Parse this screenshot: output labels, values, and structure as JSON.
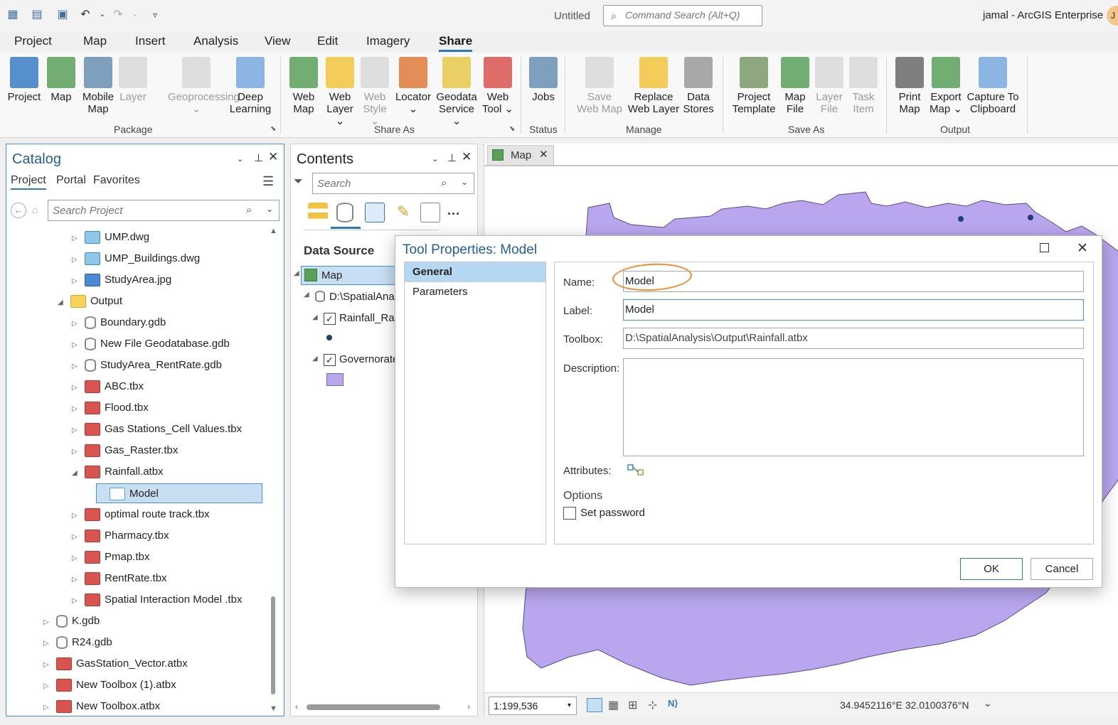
{
  "app": {
    "doc_title": "Untitled",
    "command_search_placeholder": "Command Search (Alt+Q)",
    "user_label": "jamal - ArcGIS Enterprise",
    "avatar_initial": "J"
  },
  "menu_tabs": [
    "Project",
    "Map",
    "Insert",
    "Analysis",
    "View",
    "Edit",
    "Imagery",
    "Share"
  ],
  "active_tab": "Share",
  "ribbon": {
    "groups": [
      {
        "label": "Package"
      },
      {
        "label": "Share As"
      },
      {
        "label": "Status"
      },
      {
        "label": "Manage"
      },
      {
        "label": "Save As"
      },
      {
        "label": "Output"
      }
    ],
    "buttons": [
      {
        "l1": "Project",
        "l2": "",
        "enabled": true,
        "color": "#3a7dc4"
      },
      {
        "l1": "Map",
        "l2": "",
        "enabled": true,
        "color": "#5aa05a"
      },
      {
        "l1": "Mobile",
        "l2": "Map",
        "enabled": true,
        "color": "#6a8fb5"
      },
      {
        "l1": "Layer",
        "l2": "",
        "enabled": false,
        "color": "#c9c9c9"
      },
      {
        "l1": "Geoprocessing",
        "l2": "⌄",
        "enabled": false,
        "color": "#c9c9c9"
      },
      {
        "l1": "Deep",
        "l2": "Learning",
        "enabled": true,
        "color": "#7aa9e0"
      },
      {
        "l1": "Web",
        "l2": "Map",
        "enabled": true,
        "color": "#5aa05a"
      },
      {
        "l1": "Web",
        "l2": "Layer ⌄",
        "enabled": true,
        "color": "#f2c43d"
      },
      {
        "l1": "Web",
        "l2": "Style ⌄",
        "enabled": false,
        "color": "#c9c9c9"
      },
      {
        "l1": "Locator",
        "l2": "⌄",
        "enabled": true,
        "color": "#e07a3a"
      },
      {
        "l1": "Geodata",
        "l2": "Service ⌄",
        "enabled": true,
        "color": "#e6c84a"
      },
      {
        "l1": "Web",
        "l2": "Tool ⌄",
        "enabled": true,
        "color": "#d9534f"
      },
      {
        "l1": "Jobs",
        "l2": "",
        "enabled": true,
        "color": "#6a8fb5"
      },
      {
        "l1": "Save",
        "l2": "Web Map",
        "enabled": false,
        "color": "#c9c9c9"
      },
      {
        "l1": "Replace",
        "l2": "Web Layer",
        "enabled": true,
        "color": "#f2c43d"
      },
      {
        "l1": "Data",
        "l2": "Stores",
        "enabled": true,
        "color": "#9a9a9a"
      },
      {
        "l1": "Project",
        "l2": "Template",
        "enabled": true,
        "color": "#7a9a6a"
      },
      {
        "l1": "Map",
        "l2": "File",
        "enabled": true,
        "color": "#5aa05a"
      },
      {
        "l1": "Layer",
        "l2": "File",
        "enabled": false,
        "color": "#c9c9c9"
      },
      {
        "l1": "Task",
        "l2": "Item",
        "enabled": false,
        "color": "#c9c9c9"
      },
      {
        "l1": "Print",
        "l2": "Map",
        "enabled": true,
        "color": "#6a6a6a"
      },
      {
        "l1": "Export",
        "l2": "Map ⌄",
        "enabled": true,
        "color": "#5aa05a"
      },
      {
        "l1": "Capture To",
        "l2": "Clipboard",
        "enabled": true,
        "color": "#7aa9e0"
      }
    ]
  },
  "catalog": {
    "title": "Catalog",
    "tabs": [
      "Project",
      "Portal",
      "Favorites"
    ],
    "search_placeholder": "Search Project",
    "items": [
      {
        "label": "UMP.dwg",
        "type": "dwg",
        "level": 2,
        "exp": "closed"
      },
      {
        "label": "UMP_Buildings.dwg",
        "type": "dwg",
        "level": 2,
        "exp": "closed"
      },
      {
        "label": "StudyArea.jpg",
        "type": "jpg",
        "level": 2,
        "exp": "closed"
      },
      {
        "label": "Output",
        "type": "folder",
        "level": 1,
        "exp": "open"
      },
      {
        "label": "Boundary.gdb",
        "type": "gdb",
        "level": 2,
        "exp": "closed"
      },
      {
        "label": "New File Geodatabase.gdb",
        "type": "gdb",
        "level": 2,
        "exp": "closed"
      },
      {
        "label": "StudyArea_RentRate.gdb",
        "type": "gdb",
        "level": 2,
        "exp": "closed"
      },
      {
        "label": "ABC.tbx",
        "type": "tbx",
        "level": 2,
        "exp": "closed"
      },
      {
        "label": "Flood.tbx",
        "type": "tbx",
        "level": 2,
        "exp": "closed"
      },
      {
        "label": "Gas Stations_Cell Values.tbx",
        "type": "tbx",
        "level": 2,
        "exp": "closed"
      },
      {
        "label": "Gas_Raster.tbx",
        "type": "tbx",
        "level": 2,
        "exp": "closed"
      },
      {
        "label": "Rainfall.atbx",
        "type": "tbx",
        "level": 2,
        "exp": "open"
      },
      {
        "label": "Model",
        "type": "model",
        "level": 3,
        "exp": "none",
        "selected": true
      },
      {
        "label": "optimal route track.tbx",
        "type": "tbx",
        "level": 2,
        "exp": "closed"
      },
      {
        "label": "Pharmacy.tbx",
        "type": "tbx",
        "level": 2,
        "exp": "closed"
      },
      {
        "label": "Pmap.tbx",
        "type": "tbx",
        "level": 2,
        "exp": "closed"
      },
      {
        "label": "RentRate.tbx",
        "type": "tbx",
        "level": 2,
        "exp": "closed"
      },
      {
        "label": "Spatial Interaction Model .tbx",
        "type": "tbx",
        "level": 2,
        "exp": "closed"
      },
      {
        "label": "K.gdb",
        "type": "gdb",
        "level": 0,
        "exp": "closed"
      },
      {
        "label": "R24.gdb",
        "type": "gdb",
        "level": 0,
        "exp": "closed"
      },
      {
        "label": "GasStation_Vector.atbx",
        "type": "tbx",
        "level": 0,
        "exp": "closed"
      },
      {
        "label": "New Toolbox (1).atbx",
        "type": "tbx",
        "level": 0,
        "exp": "closed"
      },
      {
        "label": "New Toolbox.atbx",
        "type": "tbx",
        "level": 0,
        "exp": "closed"
      }
    ]
  },
  "contents": {
    "title": "Contents",
    "search_placeholder": "Search",
    "section": "Data Source",
    "map_item": "Map",
    "source_item": "D:\\SpatialAna",
    "layers": [
      {
        "label": "Rainfall_Rar",
        "checked": true
      },
      {
        "label": "Governorate",
        "checked": true
      }
    ]
  },
  "map": {
    "tab_label": "Map",
    "scale": "1:199,536",
    "coordinates": "34.9452116°E 32.0100376°N",
    "fill_color": "#b9a6ee"
  },
  "dialog": {
    "title": "Tool Properties: Model",
    "nav": [
      "General",
      "Parameters"
    ],
    "active_nav": "General",
    "name_label": "Name:",
    "name_value": "Model",
    "label_label": "Label:",
    "label_value": "Model",
    "toolbox_label": "Toolbox:",
    "toolbox_value": "D:\\SpatialAnalysis\\Output\\Rainfall.atbx",
    "description_label": "Description:",
    "description_value": "",
    "attributes_label": "Attributes:",
    "options_label": "Options",
    "password_label": "Set password",
    "ok_label": "OK",
    "cancel_label": "Cancel"
  },
  "colors": {
    "accent": "#2a7ab8",
    "annotation": "#f08a2a",
    "selection": "#c7def3"
  }
}
